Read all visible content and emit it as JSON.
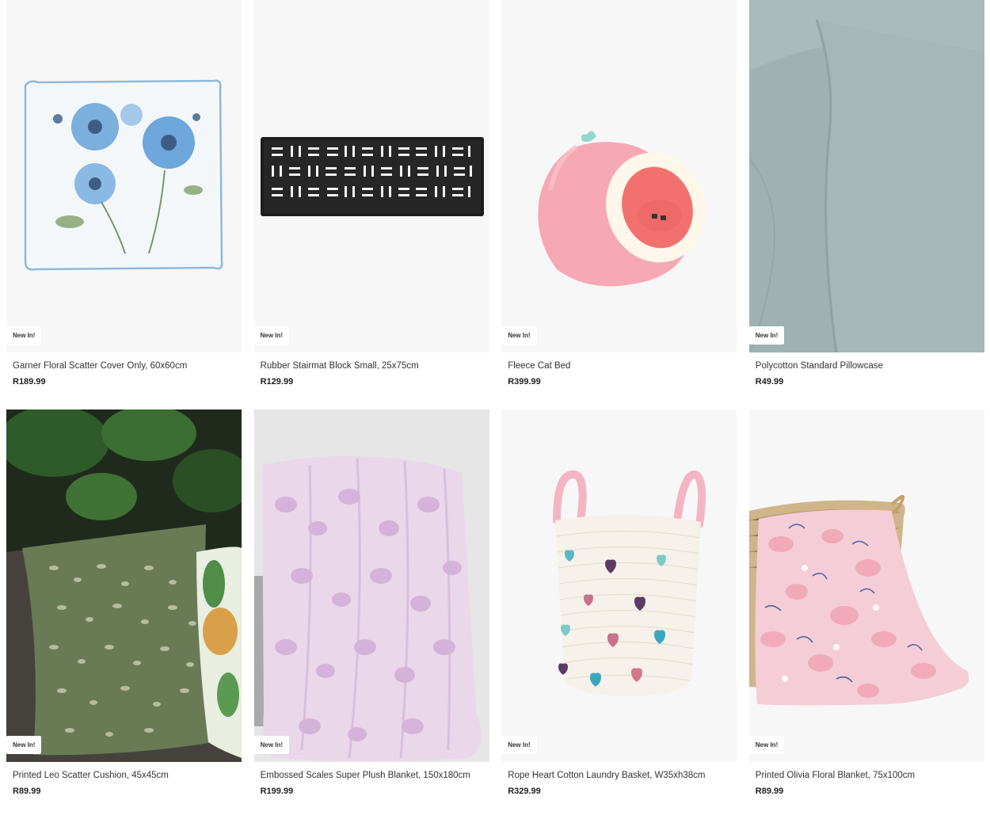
{
  "products": [
    {
      "badge": "New In!",
      "title": "Garner Floral Scatter Cover Only, 60x60cm",
      "price": "R189.99",
      "icon": "floral-cushion-image"
    },
    {
      "badge": "New In!",
      "title": "Rubber Stairmat Block Small, 25x75cm",
      "price": "R129.99",
      "icon": "stairmat-image"
    },
    {
      "badge": "New In!",
      "title": "Fleece Cat Bed",
      "price": "R399.99",
      "icon": "cat-bed-image"
    },
    {
      "badge": "New In!",
      "title": "Polycotton Standard Pillowcase",
      "price": "R49.99",
      "icon": "pillowcase-image"
    },
    {
      "badge": "New In!",
      "title": "Printed Leo Scatter Cushion, 45x45cm",
      "price": "R89.99",
      "icon": "leo-cushion-image"
    },
    {
      "badge": "New In!",
      "title": "Embossed Scales Super Plush Blanket, 150x180cm",
      "price": "R199.99",
      "icon": "plush-blanket-image"
    },
    {
      "badge": "New In!",
      "title": "Rope Heart Cotton Laundry Basket, W35xh38cm",
      "price": "R329.99",
      "icon": "laundry-basket-image"
    },
    {
      "badge": "New In!",
      "title": "Printed Olivia Floral Blanket, 75x100cm",
      "price": "R89.99",
      "icon": "floral-blanket-image"
    }
  ],
  "colors": {
    "image_bg": "#f7f7f7",
    "badge_bg": "#ffffff",
    "price_text": "#222222"
  }
}
